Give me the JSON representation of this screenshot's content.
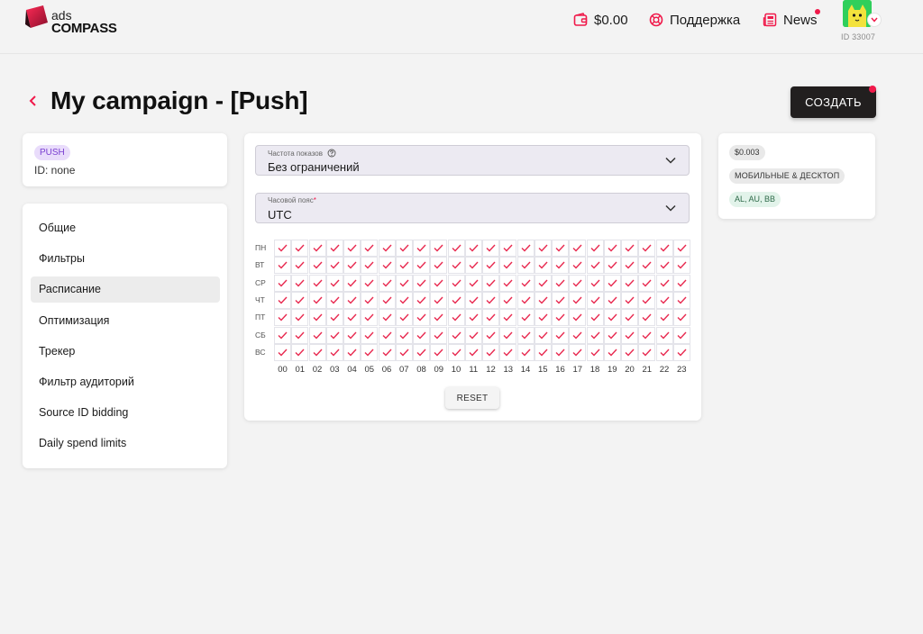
{
  "header": {
    "logo_top": "ads",
    "logo_bottom": "COMPASS",
    "balance": "$0.00",
    "support": "Поддержка",
    "news": "News",
    "user_id": "ID 33007"
  },
  "page": {
    "title": "My campaign - [Push]",
    "create_label": "СОЗДАТЬ"
  },
  "info": {
    "badge": "PUSH",
    "id_text": "ID: none"
  },
  "nav": {
    "active_index": 2,
    "items": [
      "Общие",
      "Фильтры",
      "Расписание",
      "Оптимизация",
      "Трекер",
      "Фильтр аудиторий",
      "Source ID bidding",
      "Daily spend limits"
    ]
  },
  "schedule": {
    "frequency": {
      "label": "Частота показов",
      "value": "Без ограничений"
    },
    "timezone": {
      "label": "Часовой пояс",
      "required_mark": "*",
      "value": "UTC"
    },
    "days": [
      "ПН",
      "ВТ",
      "СР",
      "ЧТ",
      "ПТ",
      "СБ",
      "ВС"
    ],
    "hours": [
      "00",
      "01",
      "02",
      "03",
      "04",
      "05",
      "06",
      "07",
      "08",
      "09",
      "10",
      "11",
      "12",
      "13",
      "14",
      "15",
      "16",
      "17",
      "18",
      "19",
      "20",
      "21",
      "22",
      "23"
    ],
    "all_checked": true,
    "reset_label": "RESET"
  },
  "summary": {
    "price": "$0.003",
    "devices": "МОБИЛЬНЫЕ & ДЕСКТОП",
    "geo": "AL, AU, BB"
  },
  "colors": {
    "accent": "#f0194a",
    "check": "#e8294f",
    "dark_button": "#221f1f",
    "push_badge_bg": "#e9dcfb",
    "geo_chip_bg": "#e2f3ea"
  },
  "icons": {
    "balance": "wallet-icon",
    "support": "lifebuoy-icon",
    "news": "newspaper-icon",
    "back": "chevron-left-icon",
    "select": "chevron-down-icon",
    "cell": "check-icon"
  }
}
